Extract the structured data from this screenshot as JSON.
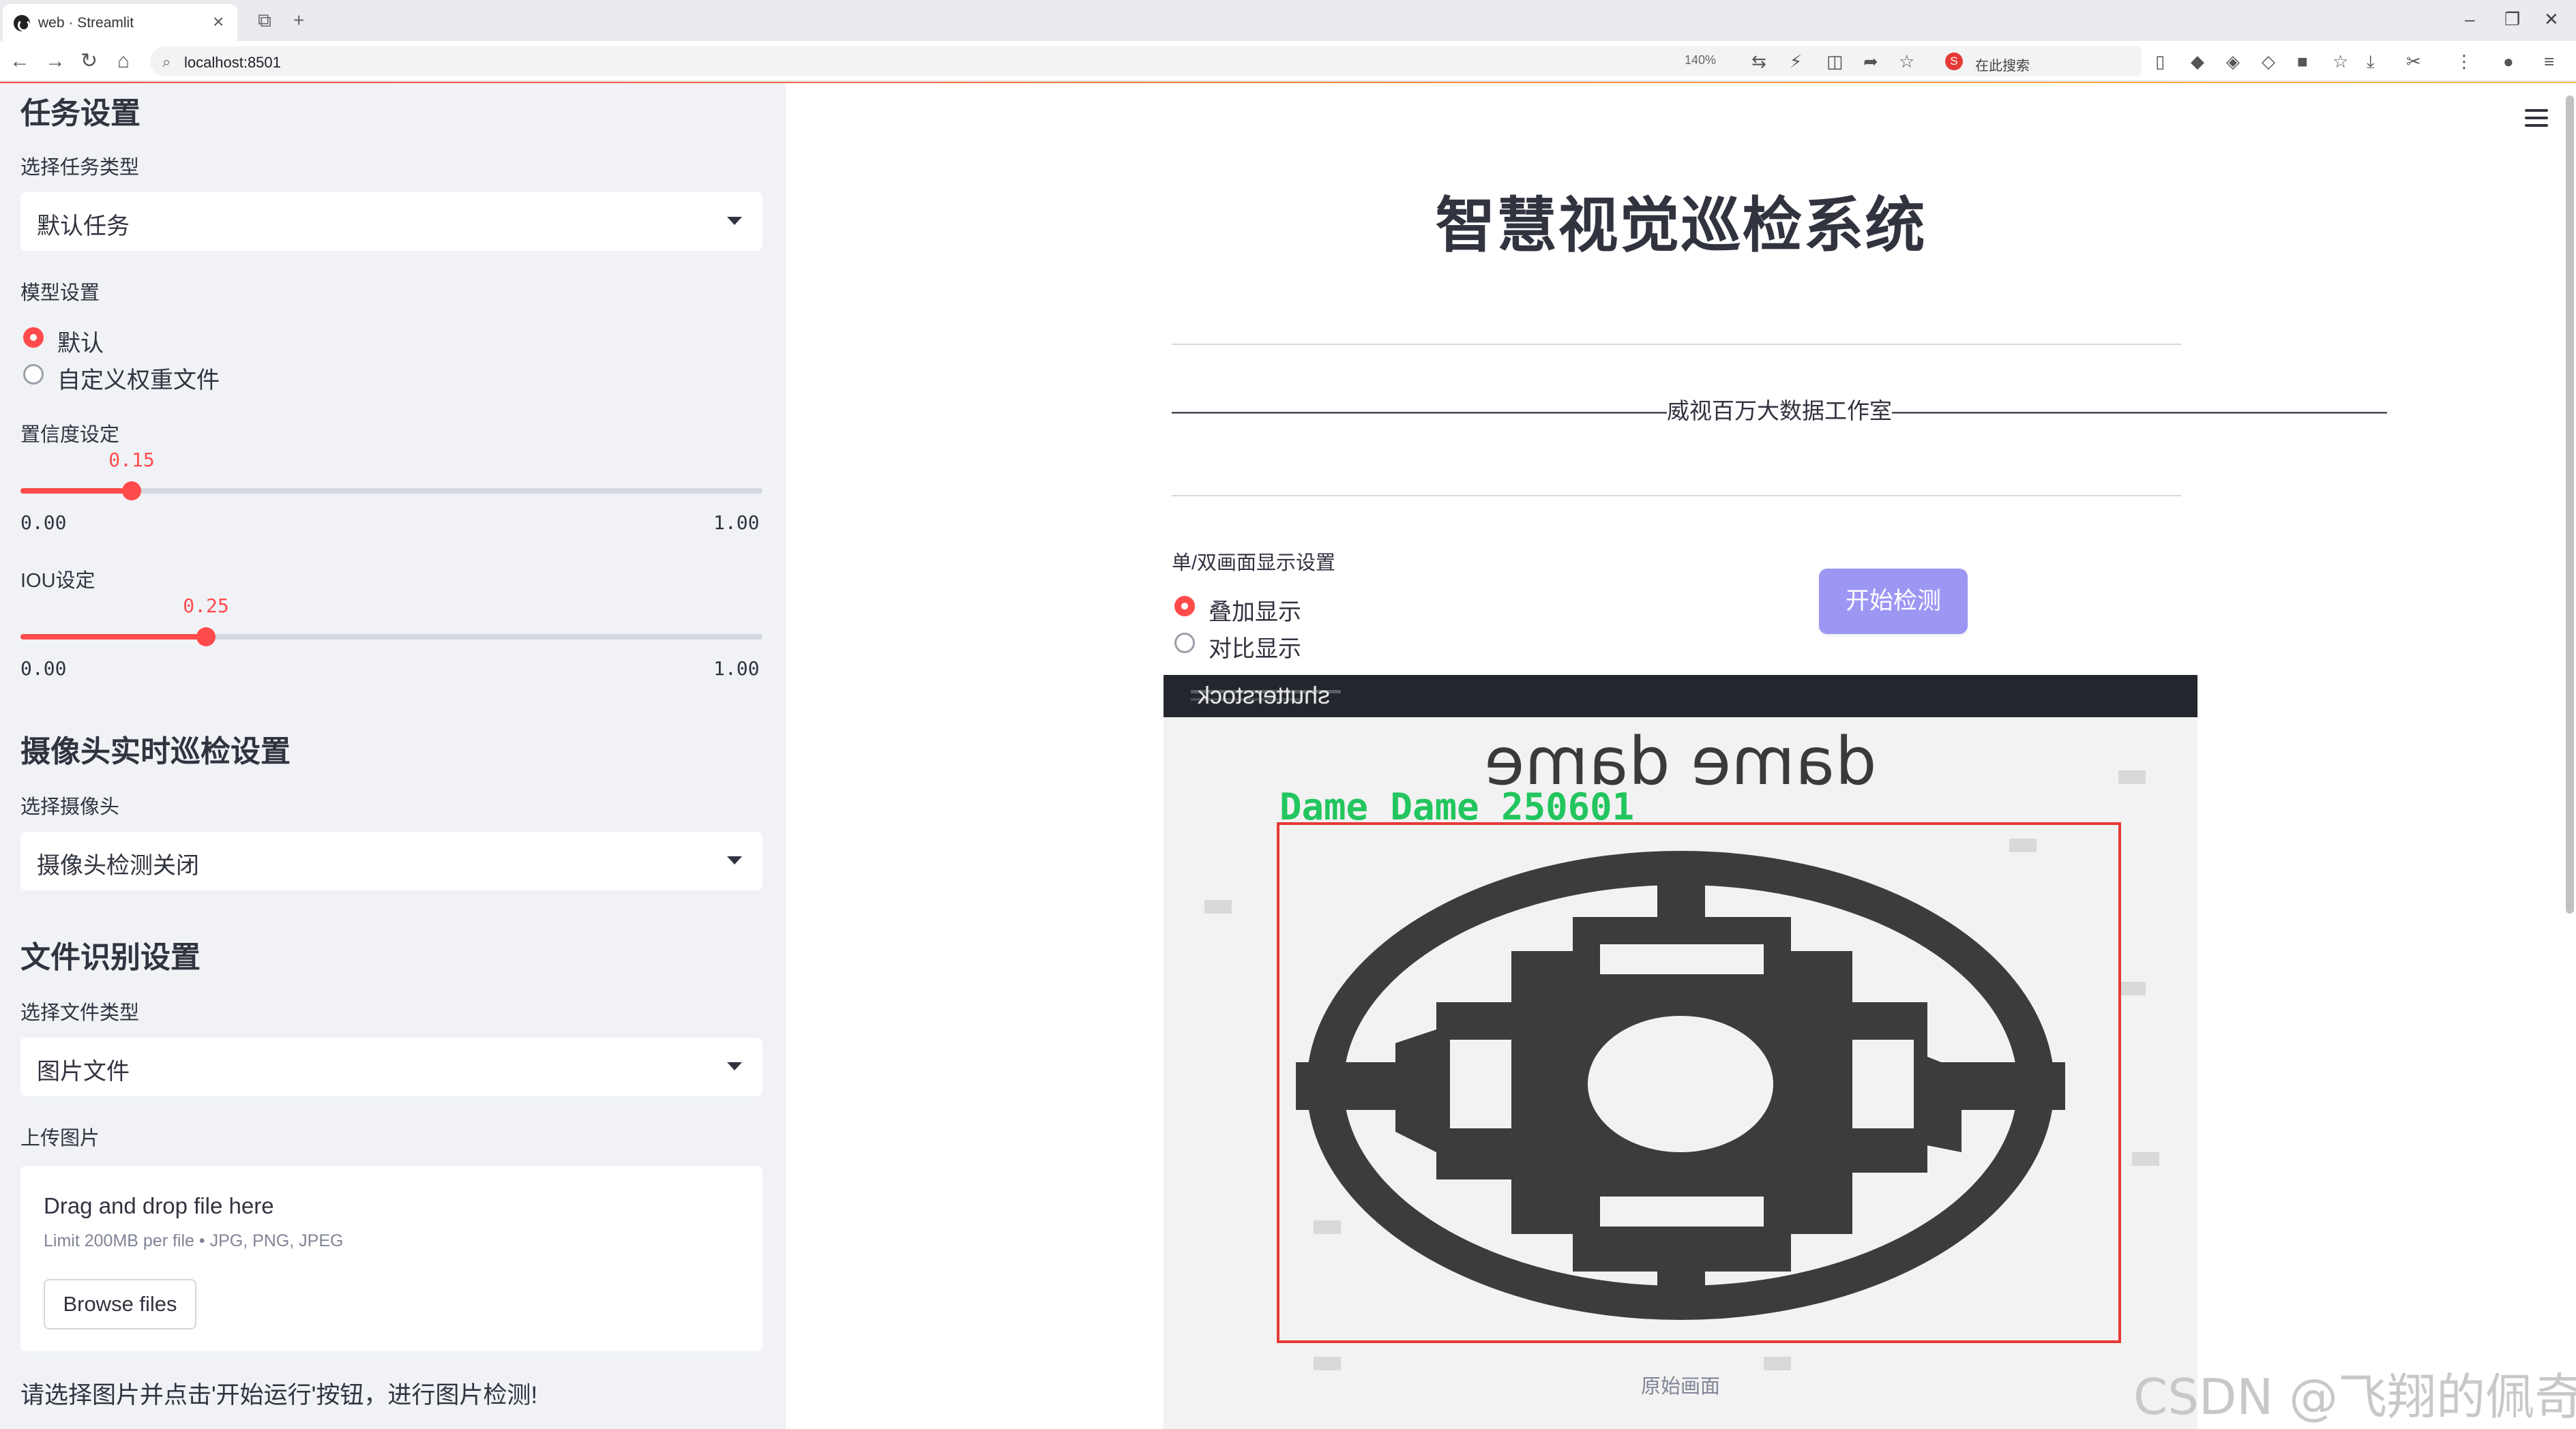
{
  "browser": {
    "tab_title": "web · Streamlit",
    "tab_close": "×",
    "new_tab": "+",
    "url": "localhost:8501",
    "zoom": "140%",
    "search_placeholder": "在此搜索",
    "search_badge": "S"
  },
  "sidebar": {
    "task_section_title": "任务设置",
    "task_type_label": "选择任务类型",
    "task_type_value": "默认任务",
    "model_label": "模型设置",
    "model_options": [
      "默认",
      "自定义权重文件"
    ],
    "model_selected": 0,
    "conf_label": "置信度设定",
    "conf": {
      "value": "0.15",
      "min": "0.00",
      "max": "1.00",
      "fraction": 0.15
    },
    "iou_label": "IOU设定",
    "iou": {
      "value": "0.25",
      "min": "0.00",
      "max": "1.00",
      "fraction": 0.25
    },
    "camera_section_title": "摄像头实时巡检设置",
    "camera_label": "选择摄像头",
    "camera_value": "摄像头检测关闭",
    "file_section_title": "文件识别设置",
    "file_type_label": "选择文件类型",
    "file_type_value": "图片文件",
    "upload_label": "上传图片",
    "upload_drag_text": "Drag and drop file here",
    "upload_limit_text": "Limit 200MB per file • JPG, PNG, JPEG",
    "browse_label": "Browse files",
    "hint_text": "请选择图片并点击'开始运行'按钮，进行图片检测!"
  },
  "main": {
    "title": "智慧视觉巡检系统",
    "studio_line": "——————————————————————威视百万大数据工作室——————————————————————",
    "display_label": "单/双画面显示设置",
    "display_options": [
      "叠加显示",
      "对比显示"
    ],
    "display_selected": 0,
    "start_button": "开始检测",
    "image_banner_text": "shutterstock",
    "image_heading_text": "dame dame",
    "detection_label": "Dame Dame 250601",
    "image_caption": "原始画面"
  },
  "watermark": "CSDN @飞翔的佩奇",
  "colors": {
    "accent": "#ff4b4b",
    "button": "#9d97f4",
    "sidebar_bg": "#f0f2f6",
    "detection_box": "#e53935",
    "detection_label": "#22c55e"
  }
}
